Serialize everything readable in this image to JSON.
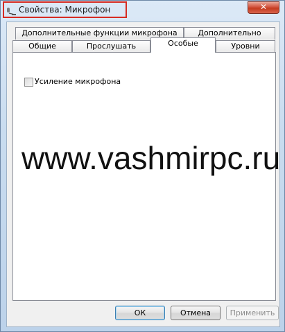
{
  "window": {
    "title": "Свойства: Микрофон",
    "close_symbol": "✕",
    "accent_highlight": "#d62b22"
  },
  "tabs": {
    "row_top": [
      {
        "label": "Дополнительные функции микрофона"
      },
      {
        "label": "Дополнительно"
      }
    ],
    "row_bottom": [
      {
        "label": "Общие"
      },
      {
        "label": "Прослушать"
      },
      {
        "label": "Особые",
        "active": true
      },
      {
        "label": "Уровни"
      }
    ]
  },
  "panel": {
    "checkbox_label": "Усиление микрофона",
    "checkbox_checked": false
  },
  "watermark": "www.vashmirpc.ru",
  "buttons": {
    "ok": "ОК",
    "cancel": "Отмена",
    "apply": "Применить"
  }
}
